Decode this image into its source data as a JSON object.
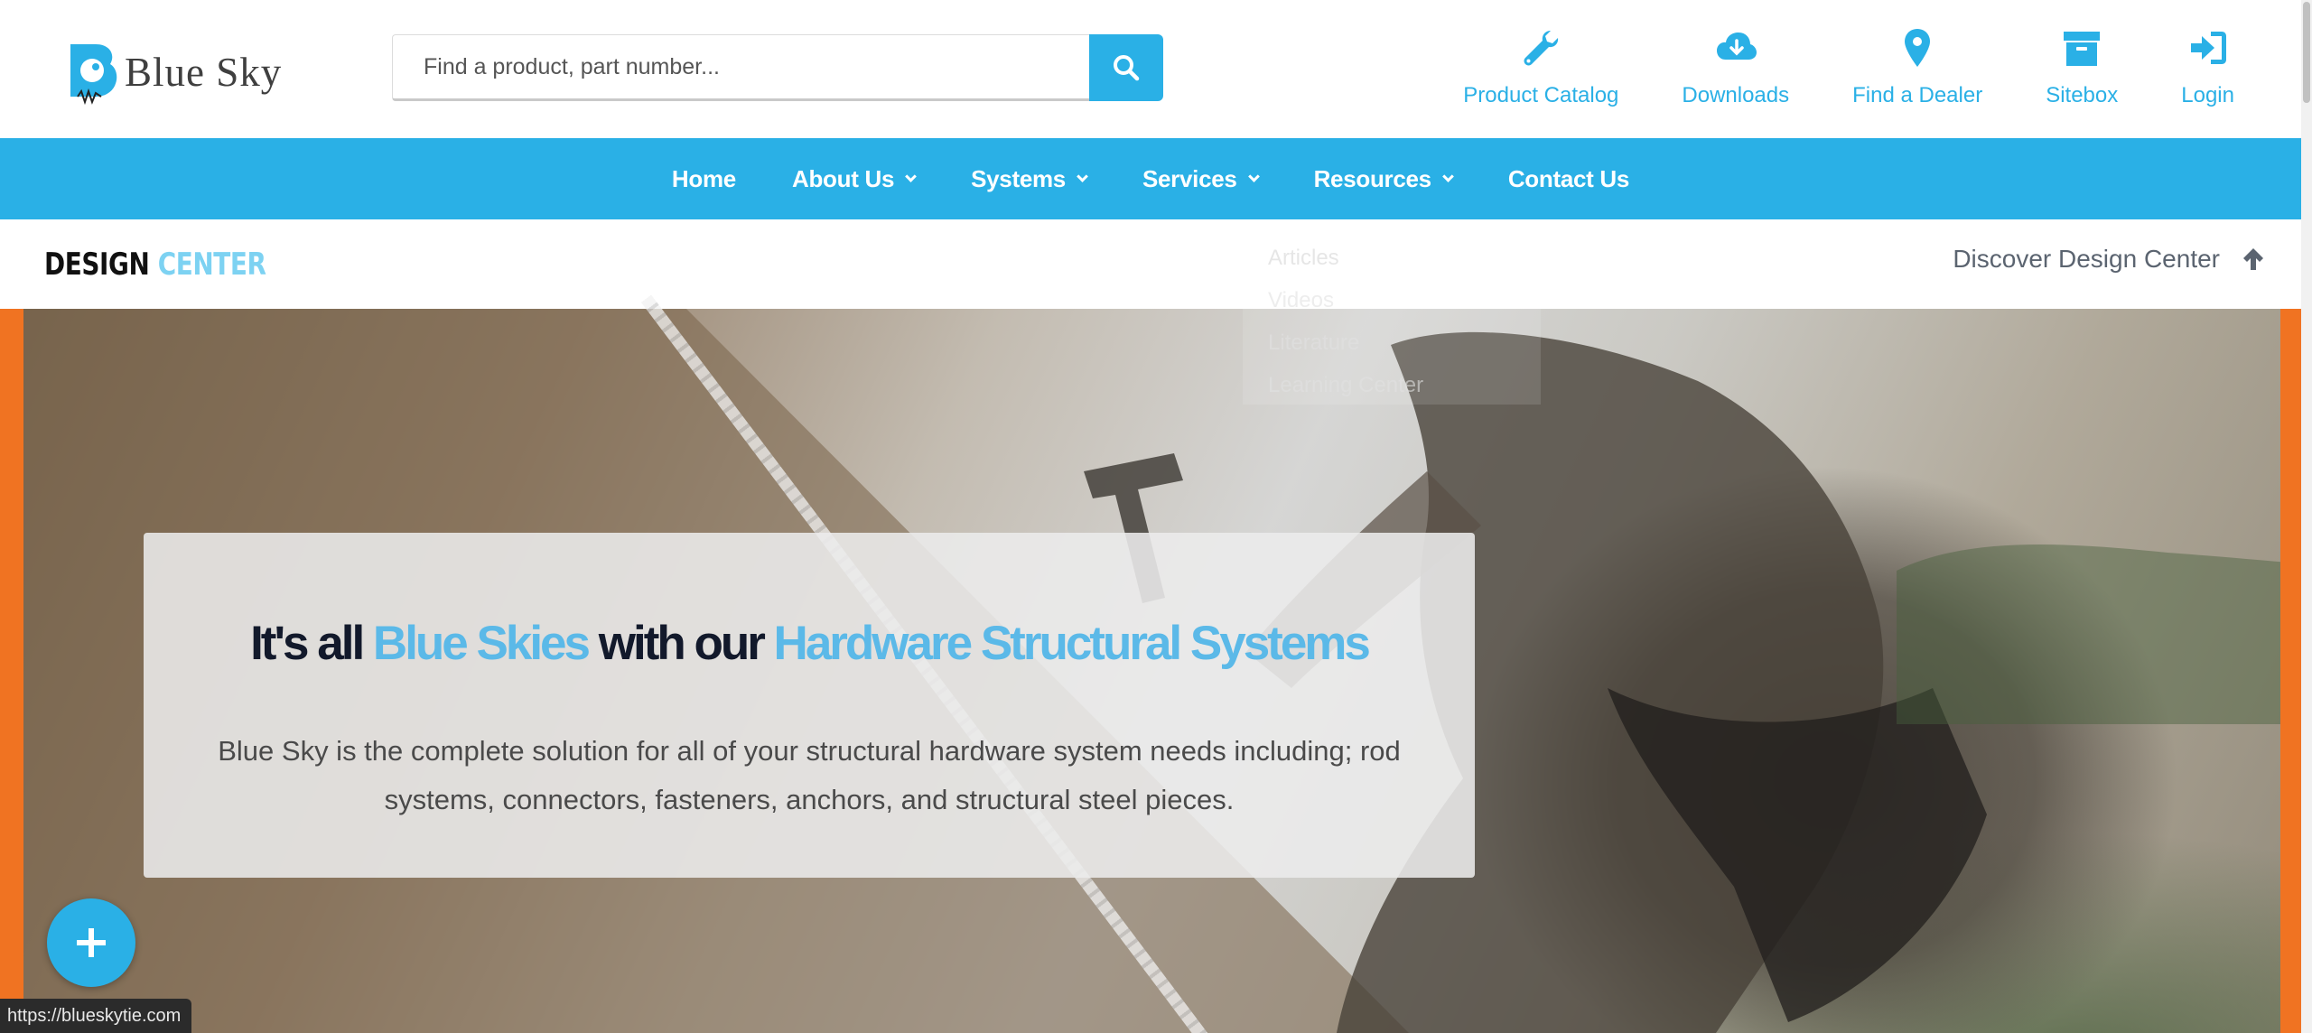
{
  "header": {
    "logo_text": "Blue Sky",
    "search": {
      "placeholder": "Find a product, part number...",
      "value": ""
    },
    "top_links": [
      {
        "label": "Product Catalog",
        "icon": "wrench-icon"
      },
      {
        "label": "Downloads",
        "icon": "cloud-download-icon"
      },
      {
        "label": "Find a Dealer",
        "icon": "map-pin-icon"
      },
      {
        "label": "Sitebox",
        "icon": "archive-box-icon"
      },
      {
        "label": "Login",
        "icon": "sign-in-icon"
      }
    ]
  },
  "nav": {
    "items": [
      {
        "label": "Home",
        "dropdown": false
      },
      {
        "label": "About Us",
        "dropdown": true
      },
      {
        "label": "Systems",
        "dropdown": true
      },
      {
        "label": "Services",
        "dropdown": true
      },
      {
        "label": "Resources",
        "dropdown": true
      },
      {
        "label": "Contact Us",
        "dropdown": false
      }
    ]
  },
  "resources_dropdown": {
    "items": [
      "Articles",
      "Videos",
      "Literature",
      "Learning Center"
    ]
  },
  "design_center": {
    "logo_part1": "DESIGN",
    "logo_part2": "CENTER",
    "discover_label": "Discover Design Center"
  },
  "hero": {
    "title_part1": "It's all ",
    "title_part2": "Blue Skies",
    "title_part3": " with our ",
    "title_part4": "Hardware Structural Systems",
    "text": "Blue Sky is the complete solution for all of your structural hardware system needs including; rod systems, connectors, fasteners, anchors, and structural steel pieces."
  },
  "status_url": "https://blueskytie.com",
  "colors": {
    "brand_blue": "#2ab0e6",
    "accent_orange": "#f07322",
    "light_blue": "#5bb9e8"
  }
}
